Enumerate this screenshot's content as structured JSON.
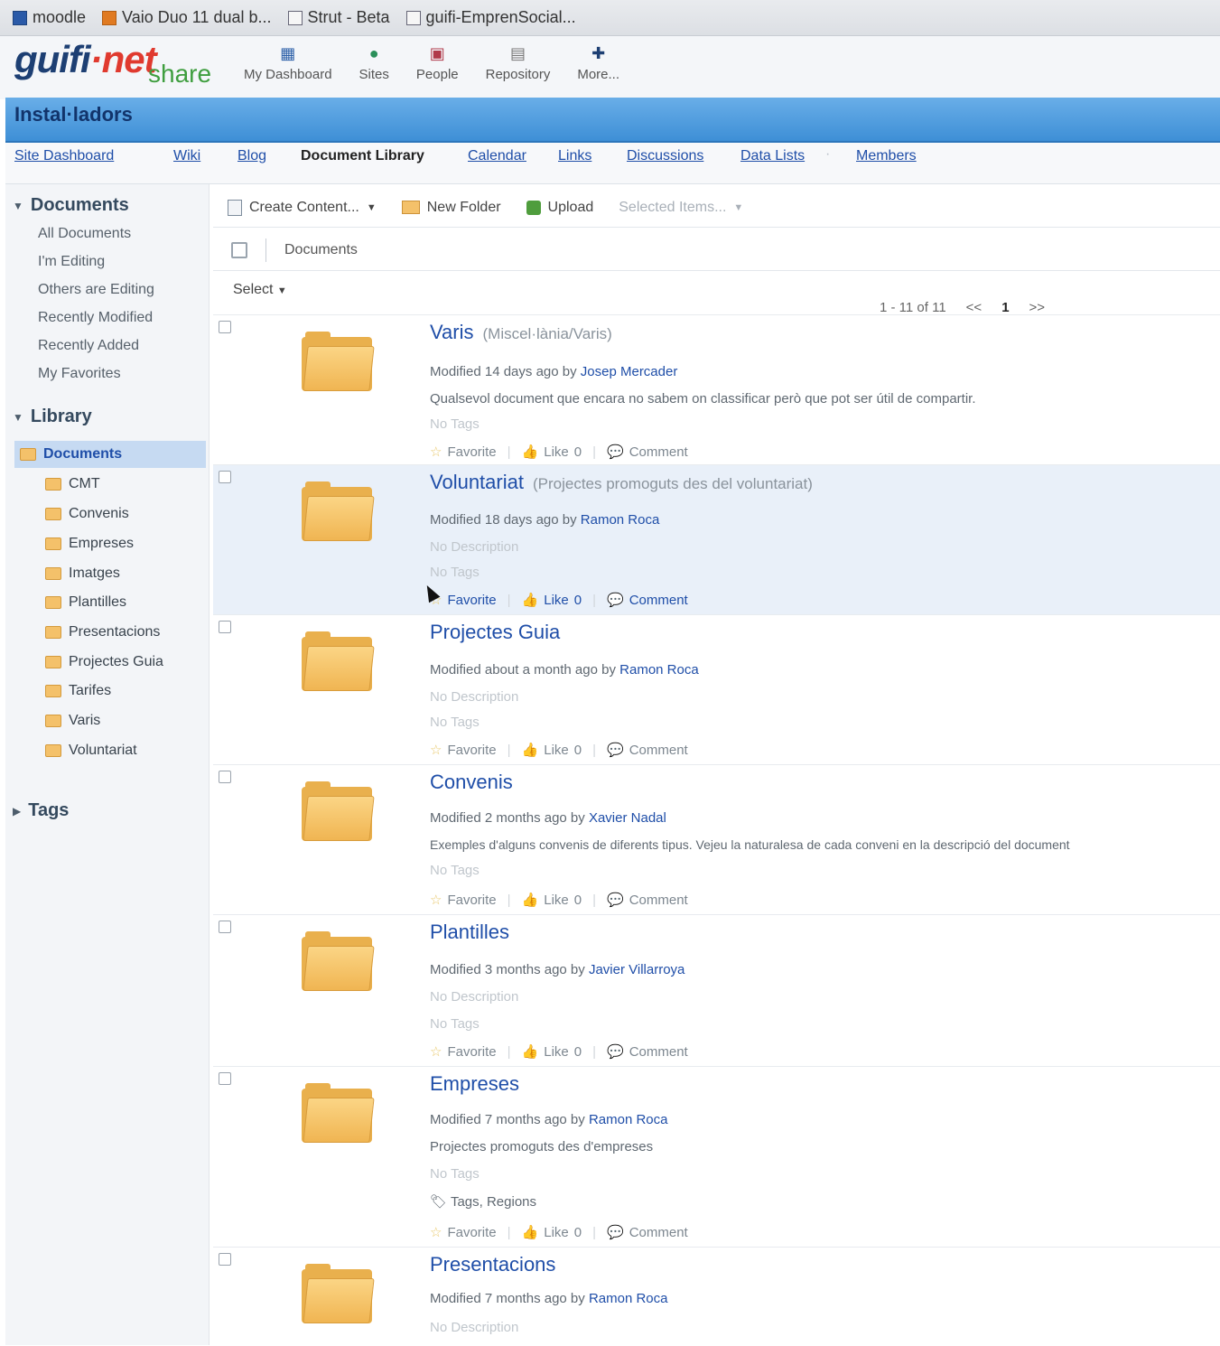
{
  "bookmarks": [
    {
      "label": "moodle",
      "icon": "moodle-icon"
    },
    {
      "label": "Vaio Duo 11 dual b...",
      "icon": "page-icon"
    },
    {
      "label": "Strut - Beta",
      "icon": "page-icon"
    },
    {
      "label": "guifi-EmprenSocial...",
      "icon": "page-icon"
    }
  ],
  "logo": {
    "guifi": "guifi",
    "dot": "·",
    "net": "net",
    "share": "share"
  },
  "appnav": [
    {
      "label": "My Dashboard",
      "icon": "dashboard-icon",
      "glyph": "▦"
    },
    {
      "label": "Sites",
      "icon": "sites-icon",
      "glyph": "●"
    },
    {
      "label": "People",
      "icon": "people-icon",
      "glyph": "▣"
    },
    {
      "label": "Repository",
      "icon": "repository-icon",
      "glyph": "▤"
    },
    {
      "label": "More...",
      "icon": "more-icon",
      "glyph": "✚"
    }
  ],
  "site": {
    "title": "Instal·ladors"
  },
  "sitenav": {
    "items": [
      "Site Dashboard",
      "Wiki",
      "Blog",
      "Document Library",
      "Calendar",
      "Links",
      "Discussions",
      "Data Lists",
      "Members"
    ],
    "separator": "·"
  },
  "sidebar": {
    "documents_header": "Documents",
    "filters": [
      "All Documents",
      "I'm Editing",
      "Others are Editing",
      "Recently Modified",
      "Recently Added",
      "My Favorites"
    ],
    "library_header": "Library",
    "library_root": "Documents",
    "folders": [
      "CMT",
      "Convenis",
      "Empreses",
      "Imatges",
      "Plantilles",
      "Presentacions",
      "Projectes Guia",
      "Tarifes",
      "Varis",
      "Voluntariat"
    ],
    "tags_header": "Tags"
  },
  "toolbar": {
    "create": "Create Content...",
    "new_folder": "New Folder",
    "upload": "Upload",
    "selected": "Selected Items..."
  },
  "breadcrumb": {
    "current": "Documents"
  },
  "list": {
    "select": "Select",
    "paging": {
      "range": "1 - 11 of 11",
      "prev": "<<",
      "page": "1",
      "next": ">>"
    }
  },
  "actions": {
    "favorite": "Favorite",
    "like": "Like",
    "like_count": "0",
    "comment": "Comment"
  },
  "documents": [
    {
      "title": "Varis",
      "path": "(Miscel·lània/Varis)",
      "modified": "Modified 14 days ago by",
      "user": "Josep Mercader",
      "description": "Qualsevol document que encara no sabem on classificar però que pot ser útil de compartir.",
      "tags": "No Tags"
    },
    {
      "title": "Voluntariat",
      "path": "(Projectes promoguts des del voluntariat)",
      "modified": "Modified 18 days ago by",
      "user": "Ramon Roca",
      "description": "No Description",
      "tags": "No Tags"
    },
    {
      "title": "Projectes Guia",
      "path": "",
      "modified": "Modified about a month ago by",
      "user": "Ramon Roca",
      "description": "No Description",
      "tags": "No Tags"
    },
    {
      "title": "Convenis",
      "path": "",
      "modified": "Modified 2 months ago by",
      "user": "Xavier Nadal",
      "description": "Exemples d'alguns convenis de diferents tipus. Vejeu la naturalesa de cada conveni en la descripció del document",
      "tags": "No Tags"
    },
    {
      "title": "Plantilles",
      "path": "",
      "modified": "Modified 3 months ago by",
      "user": "Javier Villarroya",
      "description": "No Description",
      "tags": "No Tags"
    },
    {
      "title": "Empreses",
      "path": "",
      "modified": "Modified 7 months ago by",
      "user": "Ramon Roca",
      "description": "Projectes promoguts des d'empreses",
      "tags": "No Tags",
      "tag_list": "Tags, Regions"
    },
    {
      "title": "Presentacions",
      "path": "",
      "modified": "Modified 7 months ago by",
      "user": "Ramon Roca",
      "description": "No Description",
      "tags": ""
    }
  ]
}
